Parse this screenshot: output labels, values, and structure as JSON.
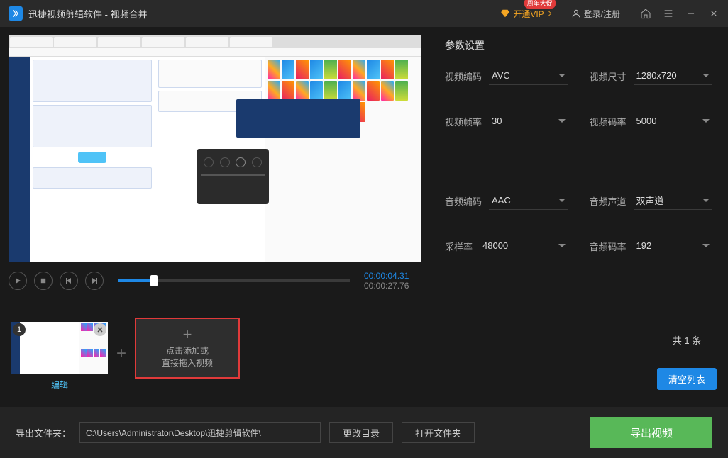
{
  "titlebar": {
    "app_name": "迅捷视频剪辑软件",
    "subtitle": "视频合并",
    "vip_label": "开通VIP",
    "vip_promo": "周年大促",
    "login_label": "登录/注册"
  },
  "player": {
    "current_time": "00:00:04.31",
    "total_time": "00:00:27.76"
  },
  "params": {
    "title": "参数设置",
    "video_codec": {
      "label": "视频编码",
      "value": "AVC"
    },
    "video_size": {
      "label": "视频尺寸",
      "value": "1280x720"
    },
    "video_fps": {
      "label": "视频帧率",
      "value": "30"
    },
    "video_bitrate": {
      "label": "视频码率",
      "value": "5000"
    },
    "audio_codec": {
      "label": "音频编码",
      "value": "AAC"
    },
    "audio_channel": {
      "label": "音频声道",
      "value": "双声道"
    },
    "sample_rate": {
      "label": "采样率",
      "value": "48000"
    },
    "audio_bitrate": {
      "label": "音频码率",
      "value": "192"
    }
  },
  "clips": {
    "clip1_index": "1",
    "edit_label": "编辑",
    "add_line1": "点击添加或",
    "add_line2": "直接拖入视频",
    "count_text": "共 1 条",
    "clear_label": "清空列表"
  },
  "export": {
    "folder_label": "导出文件夹：",
    "path": "C:\\Users\\Administrator\\Desktop\\迅捷剪辑软件\\",
    "change_dir": "更改目录",
    "open_dir": "打开文件夹",
    "export_btn": "导出视频"
  }
}
